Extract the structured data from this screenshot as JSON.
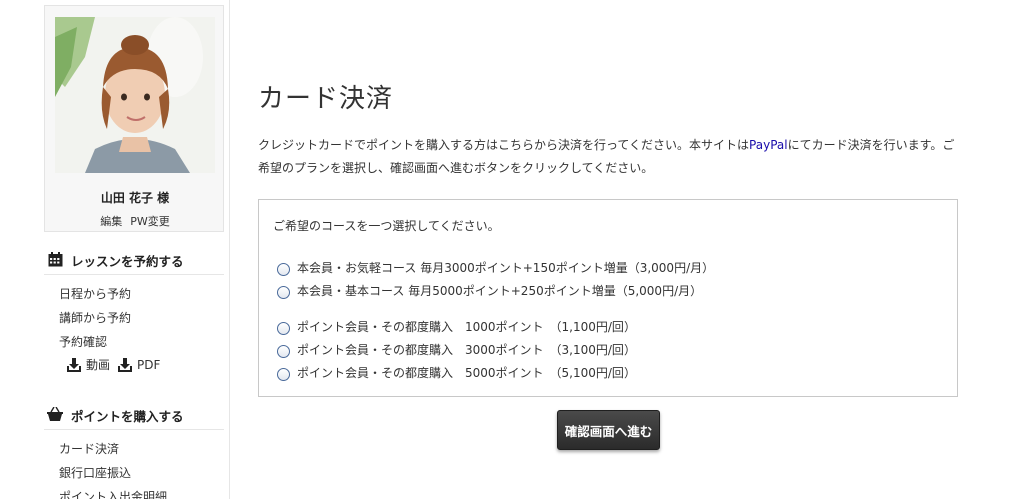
{
  "sidebar": {
    "user_name": "山田 花子 様",
    "edit_label": "編集",
    "pw_label": "PW変更",
    "lesson_section": {
      "title": "レッスンを予約する",
      "icon": "calendar-icon",
      "links": [
        "日程から予約",
        "講師から予約",
        "予約確認"
      ],
      "downloads": [
        {
          "label": "動画",
          "icon": "download-icon"
        },
        {
          "label": "PDF",
          "icon": "download-icon"
        }
      ]
    },
    "points_section": {
      "title": "ポイントを購入する",
      "icon": "basket-icon",
      "links": [
        "カード決済",
        "銀行口座振込",
        "ポイント入出金明細"
      ]
    }
  },
  "main": {
    "title": "カード決済",
    "intro_before_link": "クレジットカードでポイントを購入する方はこちらから決済を行ってください。本サイトは",
    "intro_link": "PayPal",
    "intro_after_link": "にてカード決済を行います。ご希望のプランを選択し、確認画面へ進むボタンをクリックしてください。",
    "course_prompt": "ご希望のコースを一つ選択してください。",
    "options": [
      "本会員・お気軽コース 毎月3000ポイント+150ポイント増量（3,000円/月）",
      "本会員・基本コース 毎月5000ポイント+250ポイント増量（5,000円/月）",
      "ポイント会員・その都度購入　1000ポイント　（1,100円/回）",
      "ポイント会員・その都度購入　3000ポイント　（3,100円/回）",
      "ポイント会員・その都度購入　5000ポイント　（5,100円/回）"
    ],
    "confirm_button": "確認画面へ進む"
  },
  "colors": {
    "link": "#1a0dab",
    "button_bg": "#333333",
    "radio_border": "#4a6a9a",
    "sidebar_card_bg": "#f7f7f7"
  }
}
